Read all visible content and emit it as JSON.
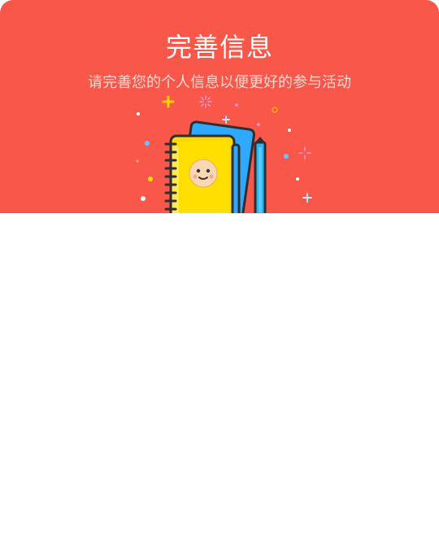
{
  "header": {
    "title": "完善信息",
    "subtitle": "请完善您的个人信息以便更好的参与活动"
  },
  "illustration": {
    "icon": "notebook-icon"
  },
  "colors": {
    "header_bg": "#f8574a",
    "title": "#ffffff",
    "subtitle": "#ffd9d4"
  }
}
